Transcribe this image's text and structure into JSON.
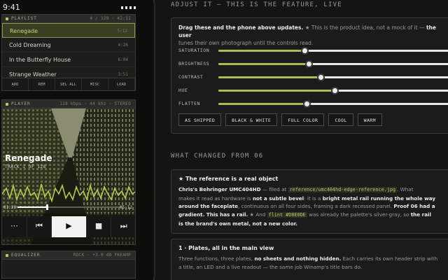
{
  "status_bar": {
    "time": "9:41"
  },
  "playlist": {
    "title": "PLAYLIST",
    "readout": "4 / 128 · 42:11",
    "tracks": [
      {
        "name": "Renegade",
        "duration": "5:12",
        "active": true
      },
      {
        "name": "Cold Dreaming",
        "duration": "4:26",
        "active": false
      },
      {
        "name": "In the Butterfly House",
        "duration": "6:04",
        "active": false
      },
      {
        "name": "Strange Weather",
        "duration": "3:51",
        "active": false
      }
    ],
    "buttons": [
      "ADD",
      "REM",
      "SEL ALL",
      "MISC",
      "LOAD"
    ]
  },
  "player": {
    "title": "PLAYER",
    "readout": "128 kbps · 44 khz · STEREO",
    "song": "Renegade",
    "track": "TRACK 1 OF 128",
    "elapsed": "01:28",
    "total": "05:12",
    "progress": 0.28
  },
  "equalizer": {
    "title": "EQUALIZER",
    "readout": "ROCK · +3.0 dB PREAMP"
  },
  "adjust": {
    "heading": "ADJUST IT — THIS IS THE FEATURE, LIVE",
    "intro_bold": "Drag these and the phone above updates.",
    "intro_mid": " ★ This is the product idea, not a mock of it — ",
    "intro_bold2": "the user",
    "intro_line2": "tunes their own photograph until the controls read.",
    "sliders": [
      {
        "label": "SATURATION",
        "value": 0.37
      },
      {
        "label": "BRIGHTNESS",
        "value": 0.39
      },
      {
        "label": "CONTRAST",
        "value": 0.44
      },
      {
        "label": "HUE",
        "value": 0.5
      },
      {
        "label": "FLATTEN",
        "value": 0.38
      }
    ],
    "presets": [
      "AS SHIPPED",
      "BLACK & WHITE",
      "FULL COLOR",
      "COOL",
      "WARM"
    ]
  },
  "changes": {
    "heading": "WHAT CHANGED FROM 06",
    "card1": {
      "title": "★ The reference is a real object",
      "t1": "Chris's Behringer UMC404HD",
      "t2": " — filed at ",
      "code1": "reference/umc404hd-edge-reference.jpg",
      "t3": ". What",
      "t4": "makes it read as hardware is ",
      "t5": "not a subtle bevel",
      "t6": ": it is a ",
      "t7": "bright metal rail running the whole way",
      "t8": "around the faceplate",
      "t9": ", continuous on all four sides, framing a dark recessed panel. ",
      "t10": "Proof 06 had a",
      "t11": "gradient. This has a rail.",
      "t12": " ★ And ",
      "code2": "flint #D8E0DE",
      "t13": " was already the palette's silver-gray, so ",
      "t14": "the rail",
      "t15": "is the brand's own metal, not a new color."
    },
    "card2": {
      "title": "1 · Plates, all in the main view",
      "t1": "Three functions, three plates, ",
      "t2": "no sheets and nothing hidden.",
      "t3": " Each carries its own header strip with",
      "t4": "a title, an LED and a live readout — the same job Winamp's title bars do."
    }
  }
}
